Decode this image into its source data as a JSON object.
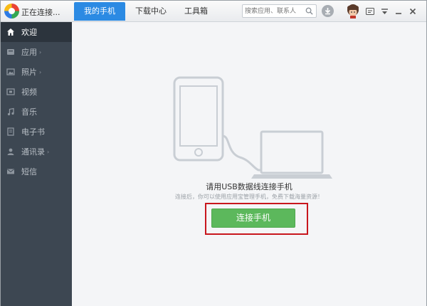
{
  "app": {
    "status": "正在连接..."
  },
  "tabs": [
    {
      "label": "我的手机",
      "active": true
    },
    {
      "label": "下载中心",
      "active": false
    },
    {
      "label": "工具箱",
      "active": false
    }
  ],
  "search": {
    "placeholder": "搜索应用、联系人"
  },
  "sidebar": {
    "items": [
      {
        "label": "欢迎",
        "icon": "home-icon",
        "active": true,
        "expandable": false
      },
      {
        "label": "应用",
        "icon": "apps-icon",
        "active": false,
        "expandable": true
      },
      {
        "label": "照片",
        "icon": "photo-icon",
        "active": false,
        "expandable": true
      },
      {
        "label": "视频",
        "icon": "video-icon",
        "active": false,
        "expandable": false
      },
      {
        "label": "音乐",
        "icon": "music-icon",
        "active": false,
        "expandable": false
      },
      {
        "label": "电子书",
        "icon": "ebook-icon",
        "active": false,
        "expandable": false
      },
      {
        "label": "通讯录",
        "icon": "contacts-icon",
        "active": false,
        "expandable": true
      },
      {
        "label": "短信",
        "icon": "sms-icon",
        "active": false,
        "expandable": false
      }
    ]
  },
  "main": {
    "title": "请用USB数据线连接手机",
    "subtitle": "连接后，你可以使用应用宝管理手机，免费下载海量资源！",
    "connect_label": "连接手机"
  },
  "colors": {
    "accent": "#2b8ae3",
    "sidebar_bg": "#3d4752",
    "button_green": "#5cb85c",
    "highlight_red": "#c8161d"
  }
}
